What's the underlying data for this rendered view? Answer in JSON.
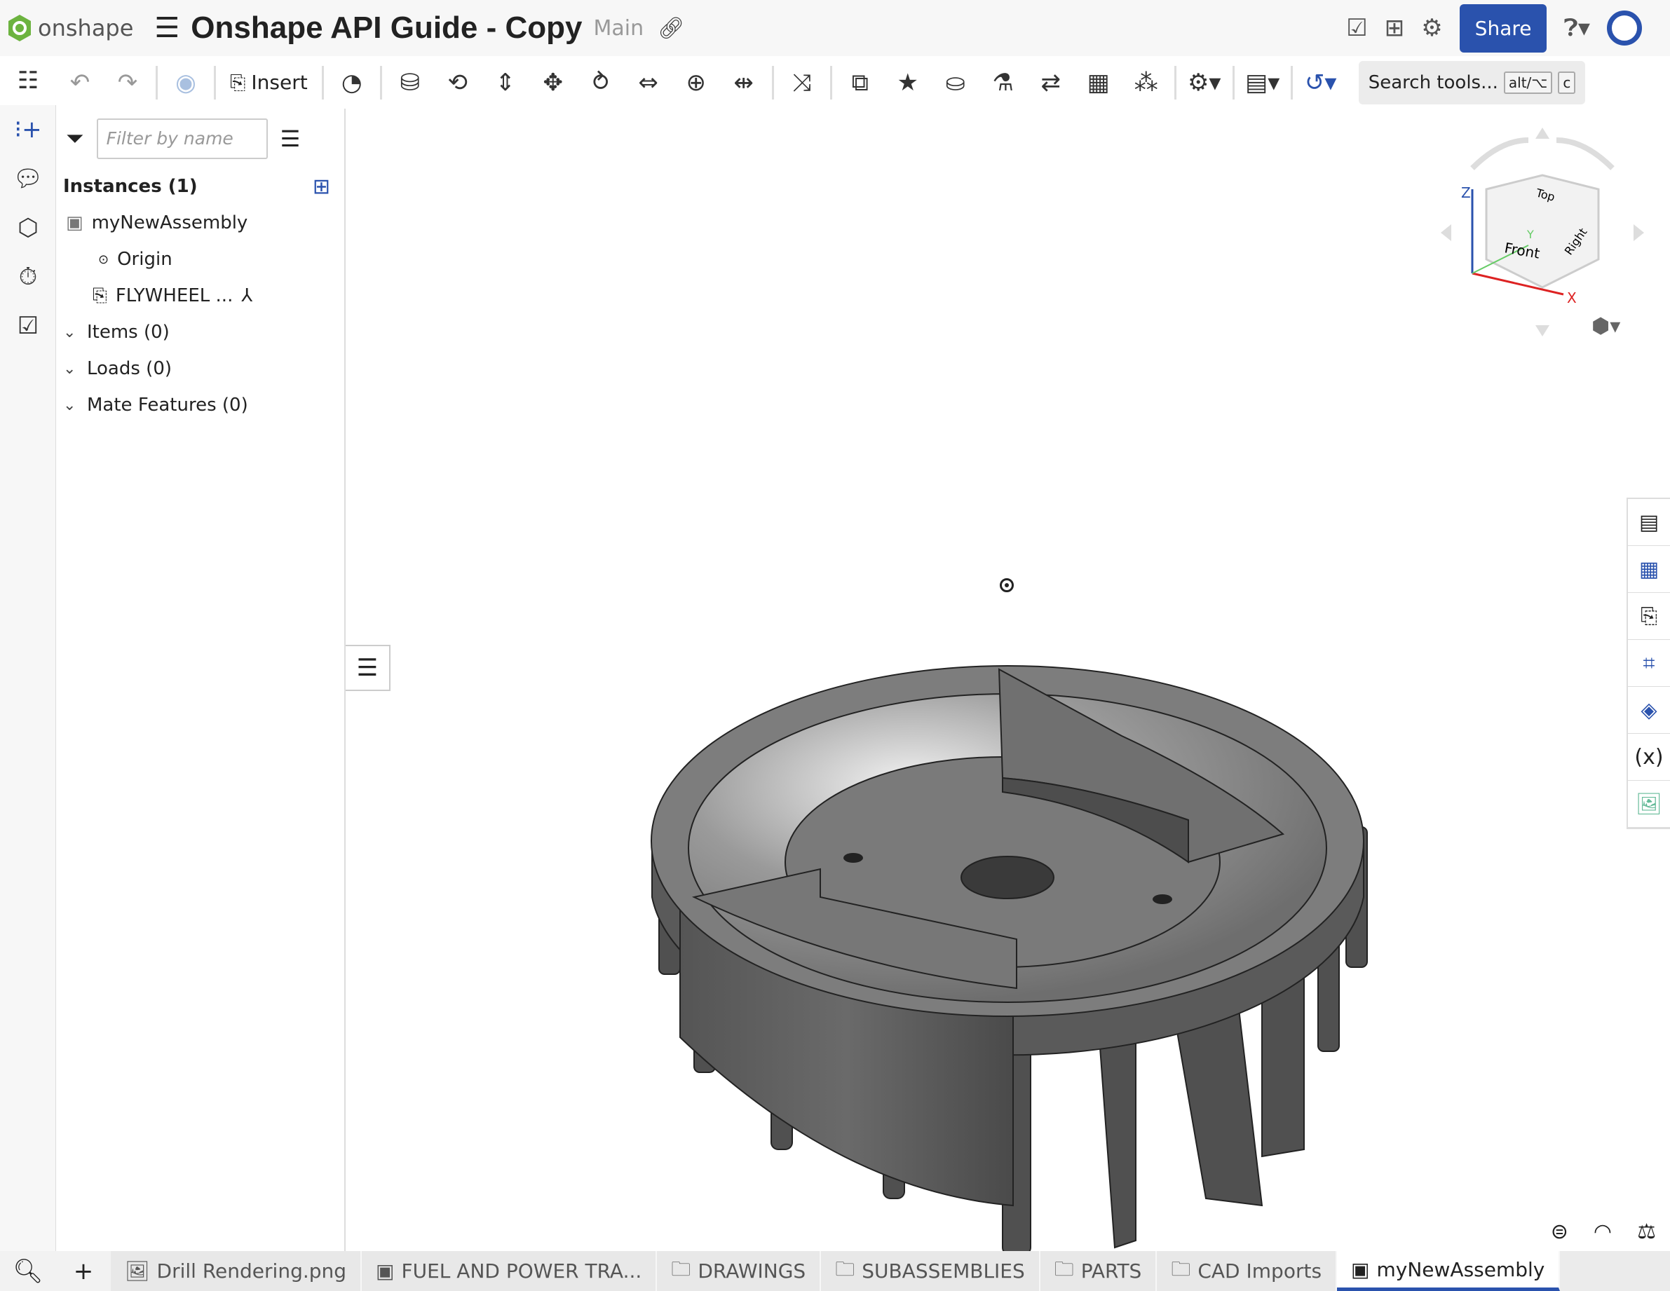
{
  "header": {
    "logo_text": "onshape",
    "title": "Onshape API Guide - Copy",
    "branch": "Main",
    "share_label": "Share",
    "brand_color": "#2a52ad"
  },
  "toolbar": {
    "insert_label": "Insert",
    "search_placeholder": "Search tools...",
    "shortcut_mod": "alt/⌥",
    "shortcut_key": "c"
  },
  "panel": {
    "filter_placeholder": "Filter by name",
    "instances_label": "Instances (1)",
    "assembly_name": "myNewAssembly",
    "origin_label": "Origin",
    "part_label": "FLYWHEEL ...",
    "items_label": "Items (0)",
    "loads_label": "Loads (0)",
    "mate_features_label": "Mate Features (0)"
  },
  "viewcube": {
    "top": "Top",
    "front": "Front",
    "right": "Right",
    "axis_x": "X",
    "axis_y": "Y",
    "axis_z": "Z"
  },
  "tabs": [
    {
      "label": "Drill Rendering.png",
      "icon": "image-icon"
    },
    {
      "label": "FUEL AND POWER TRA...",
      "icon": "assembly-icon"
    },
    {
      "label": "DRAWINGS",
      "icon": "folder-icon"
    },
    {
      "label": "SUBASSEMBLIES",
      "icon": "folder-icon"
    },
    {
      "label": "PARTS",
      "icon": "folder-icon"
    },
    {
      "label": "CAD Imports",
      "icon": "folder-icon"
    },
    {
      "label": "myNewAssembly",
      "icon": "assembly-icon",
      "active": true
    }
  ]
}
